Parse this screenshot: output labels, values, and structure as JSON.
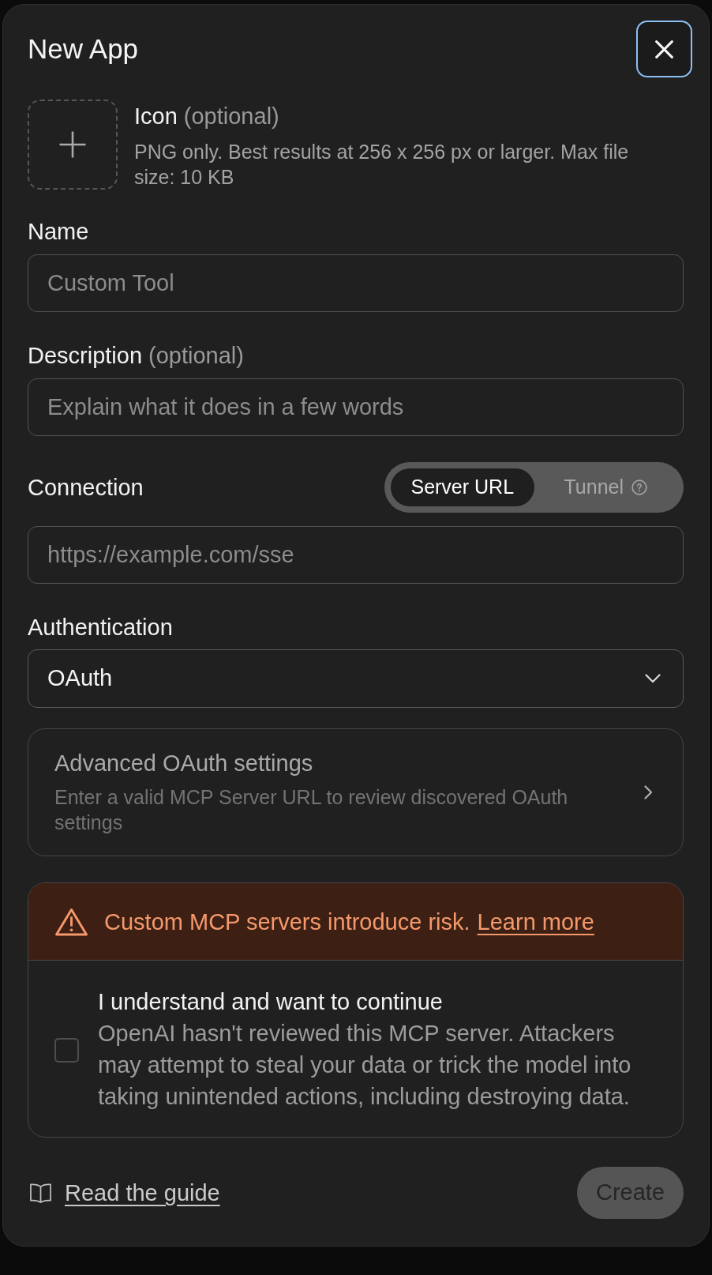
{
  "dialog": {
    "title": "New App",
    "close_button": {
      "focused": true
    }
  },
  "icon_upload": {
    "label": "Icon",
    "optional_note": "(optional)",
    "hint": "PNG only. Best results at 256 x 256 px or larger. Max file size: 10 KB"
  },
  "fields": [
    {
      "kind": "text",
      "label": "Name",
      "placeholder": "Custom Tool"
    },
    {
      "kind": "text",
      "label": "Description",
      "optional_note": "(optional)",
      "placeholder": "Explain what it does in a few words"
    },
    {
      "kind": "text",
      "label": "Connection",
      "toggle": [
        {
          "label": "Server URL",
          "selected": true
        },
        {
          "label": "Tunnel",
          "selected": false,
          "help": true
        }
      ],
      "placeholder": "https://example.com/sse"
    },
    {
      "kind": "select",
      "label": "Authentication",
      "value": "OAuth"
    }
  ],
  "advanced_card": {
    "title": "Advanced OAuth settings",
    "description": "Enter a valid MCP Server URL to review discovered OAuth settings",
    "disabled": true
  },
  "warning": {
    "message": "Custom MCP servers introduce risk.",
    "link": "Learn more",
    "consent": {
      "title": "I understand and want to continue",
      "description": "OpenAI hasn't reviewed this MCP server. Attackers may attempt to steal your data or trick the model into taking unintended actions, including destroying data.",
      "checked": false
    }
  },
  "footer": {
    "guide_link": "Read the guide",
    "create_button": {
      "label": "Create",
      "disabled": true
    }
  }
}
